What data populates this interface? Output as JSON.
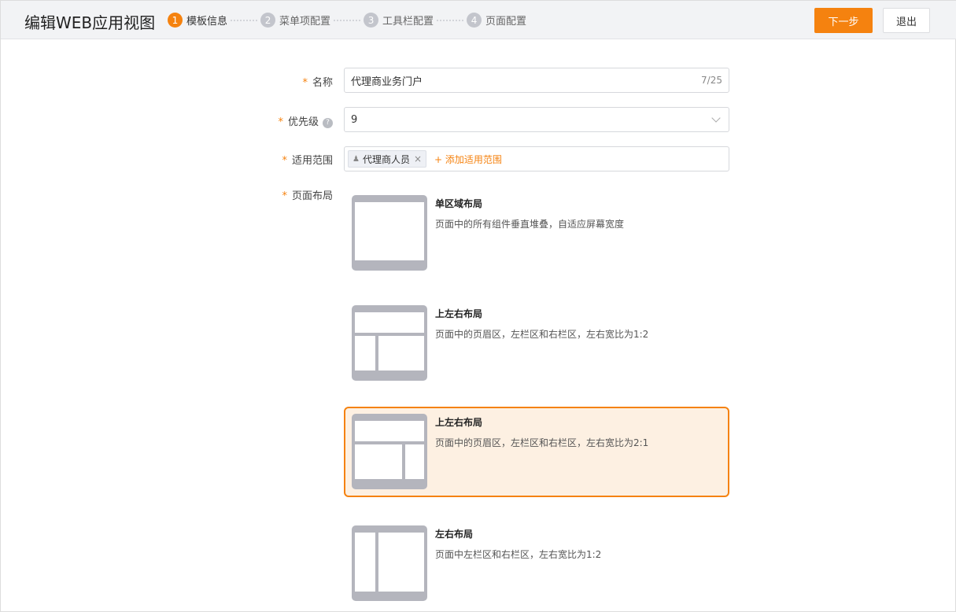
{
  "header": {
    "title": "编辑WEB应用视图",
    "steps": [
      {
        "n": "1",
        "label": "模板信息"
      },
      {
        "n": "2",
        "label": "菜单项配置"
      },
      {
        "n": "3",
        "label": "工具栏配置"
      },
      {
        "n": "4",
        "label": "页面配置"
      }
    ],
    "next": "下一步",
    "exit": "退出"
  },
  "form": {
    "name": {
      "label": "名称",
      "value": "代理商业务门户",
      "counter": "7/25"
    },
    "priority": {
      "label": "优先级",
      "value": "9",
      "help": "?"
    },
    "scope": {
      "label": "适用范围",
      "tag": "代理商人员",
      "add": "+ 添加适用范围"
    },
    "layout": {
      "label": "页面布局",
      "options": [
        {
          "title": "单区域布局",
          "desc": "页面中的所有组件垂直堆叠，自适应屏幕宽度"
        },
        {
          "title": "上左右布局",
          "desc": "页面中的页眉区，左栏区和右栏区，左右宽比为1:2"
        },
        {
          "title": "上左右布局",
          "desc": "页面中的页眉区，左栏区和右栏区，左右宽比为2:1"
        },
        {
          "title": "左右布局",
          "desc": "页面中左栏区和右栏区，左右宽比为1:2"
        }
      ],
      "selected": 2
    }
  },
  "colors": {
    "accent": "#f5820f"
  }
}
